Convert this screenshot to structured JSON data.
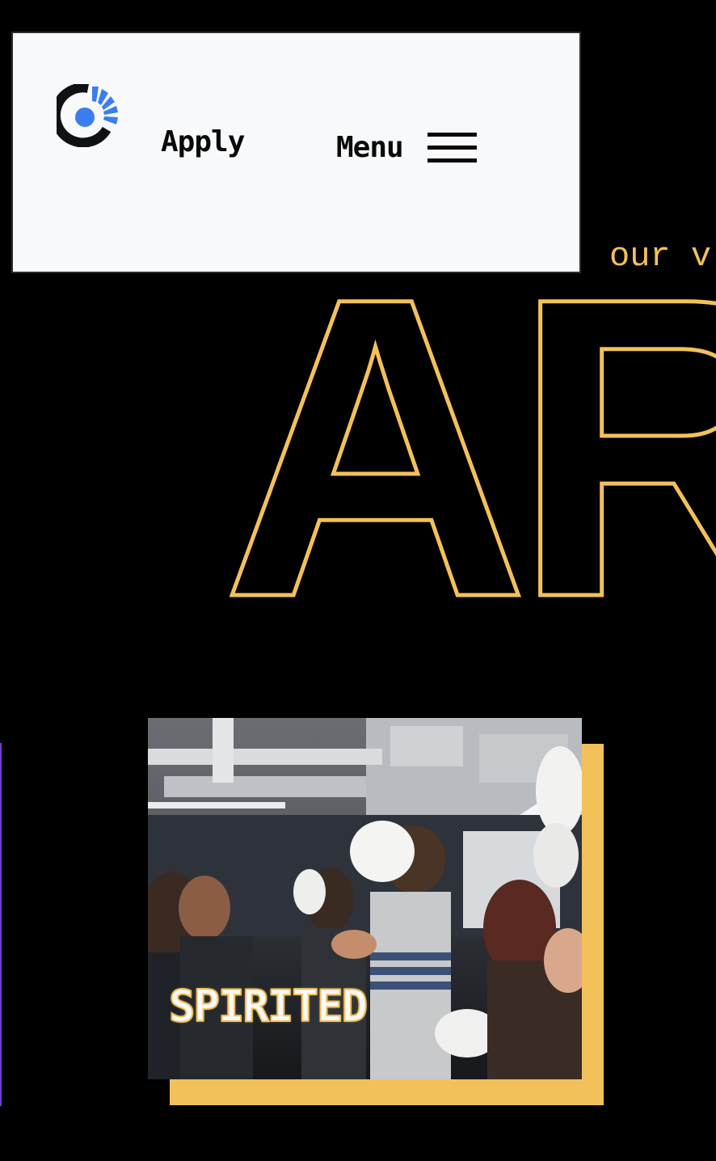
{
  "header": {
    "logo_name": "brand-logo",
    "apply_label": "Apply",
    "menu_label": "Menu"
  },
  "hero": {
    "eyebrow": "our v",
    "big_word": "AR"
  },
  "card": {
    "label": "SPIRITED"
  },
  "colors": {
    "accent_yellow": "#f3c15a",
    "brand_blue": "#3a7df0",
    "header_bg": "#f7f9fb",
    "page_bg": "#000000",
    "side_accent_purple": "#6f3bd1"
  }
}
